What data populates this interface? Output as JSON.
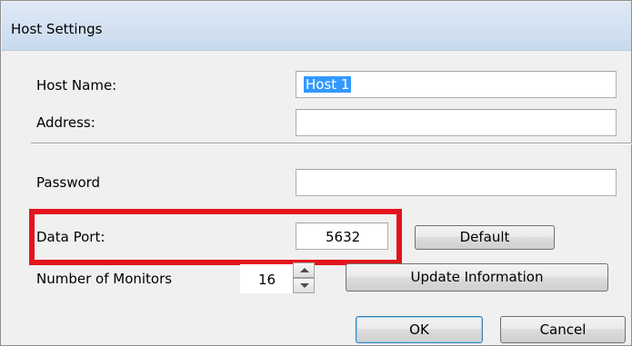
{
  "window": {
    "title": "Host Settings"
  },
  "form": {
    "host_name_label": "Host Name:",
    "host_name_value": "Host 1",
    "address_label": "Address:",
    "address_value": "",
    "password_label": "Password",
    "password_value": "",
    "data_port_label": "Data Port:",
    "data_port_value": "5632",
    "monitors_label": "Number of Monitors",
    "monitors_value": "16"
  },
  "buttons": {
    "default": "Default",
    "update": "Update Information",
    "ok": "OK",
    "cancel": "Cancel"
  },
  "colors": {
    "highlight_box": "#e3141d",
    "selection": "#3399ff"
  }
}
